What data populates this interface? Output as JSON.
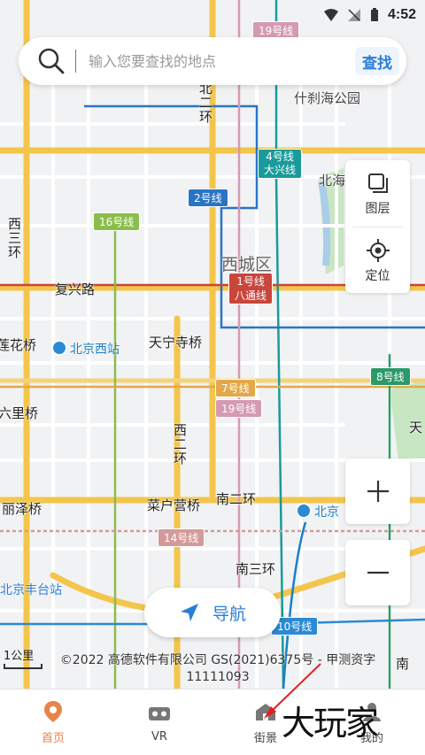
{
  "status_bar": {
    "time": "4:52"
  },
  "search": {
    "placeholder": "输入您要查找的地点",
    "button": "查找"
  },
  "side_panel": {
    "layers_label": "图层",
    "locate_label": "定位"
  },
  "map": {
    "district": "西城区",
    "roads": {
      "beier_huan": "北二环",
      "xi_san_huan": "西三环",
      "xi_er_huan": "西二环",
      "fuxing_lu": "复兴路",
      "tianningsi_qiao": "天宁寺桥",
      "lianhua_qiao": "莲花桥",
      "liulihuo_qiao": "六里桥",
      "lize_qiao": "丽泽桥",
      "caihuying_qiao": "菜户营桥",
      "nan_er_huan": "南二环",
      "nan_san_huan": "南三环",
      "nan_edge": "南",
      "tian_edge": "天"
    },
    "pois": {
      "shichahai": "什刹海公园",
      "beihai": "北海"
    },
    "stations": {
      "beijing_west": "北京西站",
      "beijing_south": "北京",
      "fengtai": "北京丰台站"
    },
    "metro": [
      {
        "label": "19号线",
        "color": "#d59ab2"
      },
      {
        "label": "4号线\n大兴线",
        "color": "#1a9a9b"
      },
      {
        "label": "2号线",
        "color": "#2a74c5"
      },
      {
        "label": "16号线",
        "color": "#8bbd4c"
      },
      {
        "label": "1号线\n八通线",
        "color": "#c8463c"
      },
      {
        "label": "8号线",
        "color": "#2a9a69"
      },
      {
        "label": "7号线",
        "color": "#e2a84a"
      },
      {
        "label": "19号线",
        "color": "#d59ab2"
      },
      {
        "label": "14号线",
        "color": "#d49a9a"
      },
      {
        "label": "10号线",
        "color": "#2a8ad6"
      }
    ]
  },
  "nav_button": {
    "label": "导航"
  },
  "scale": {
    "label": "1公里"
  },
  "copyright": "©2022 高德软件有限公司 GS(2021)6375号 - 甲测资字11111093",
  "tabs": [
    {
      "label": "首页",
      "icon": "location-pin-icon",
      "active": true
    },
    {
      "label": "VR",
      "icon": "vr-headset-icon",
      "active": false
    },
    {
      "label": "街景",
      "icon": "street-view-icon",
      "active": false
    },
    {
      "label": "我的",
      "icon": "profile-icon",
      "active": false
    }
  ],
  "watermark": "大玩家",
  "colors": {
    "accent": "#2a7ed8",
    "tab_active": "#e8844a",
    "road_major": "#f5c84a",
    "road_minor": "#ffffff"
  }
}
